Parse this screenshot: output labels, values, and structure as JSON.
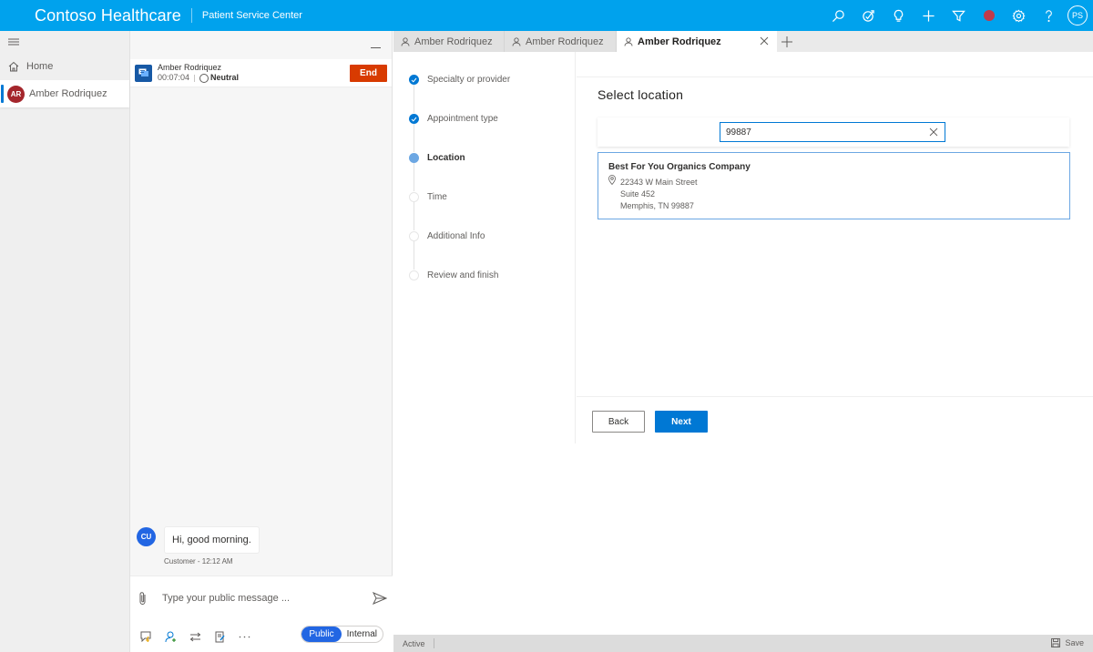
{
  "app": {
    "title": "Contoso Healthcare",
    "subtitle": "Patient Service Center",
    "brand_color": "#00a2ed",
    "header_actions": [
      {
        "name": "search-icon",
        "label": "Search"
      },
      {
        "name": "assistant-icon",
        "label": "Assistant"
      },
      {
        "name": "lightbulb-icon",
        "label": "Insights"
      },
      {
        "name": "plus-icon",
        "label": "New"
      },
      {
        "name": "filter-icon",
        "label": "Filter"
      },
      {
        "name": "presence-status-icon",
        "label": "Presence",
        "color": "#c23a4a"
      },
      {
        "name": "gear-icon",
        "label": "Settings"
      },
      {
        "name": "help-icon",
        "label": "Help"
      }
    ],
    "user_initials": "PS"
  },
  "leftnav": {
    "home_label": "Home",
    "session": {
      "initials": "AR",
      "name": "Amber Rodriquez",
      "avatar_color": "#a4262c"
    }
  },
  "conversation": {
    "session_card": {
      "name": "Amber Rodriquez",
      "timer": "00:07:04",
      "sentiment": "Neutral",
      "end_label": "End",
      "end_color": "#d83b01"
    },
    "messages": [
      {
        "initials": "CU",
        "text": "Hi, good morning.",
        "meta": "Customer - 12:12 AM"
      }
    ],
    "composer": {
      "placeholder": "Type your public message ...",
      "value": "",
      "toggle": {
        "options": [
          "Public",
          "Internal"
        ],
        "selected": "Public"
      }
    },
    "tools": [
      "quick-replies-icon",
      "consult-icon",
      "transfer-icon",
      "notes-icon",
      "more-icon"
    ]
  },
  "tabs": [
    {
      "label": "Amber Rodriquez",
      "active": false
    },
    {
      "label": "Amber Rodriquez",
      "active": false
    },
    {
      "label": "Amber Rodriquez",
      "active": true
    }
  ],
  "stepper": {
    "steps": [
      {
        "label": "Specialty or provider",
        "state": "done"
      },
      {
        "label": "Appointment type",
        "state": "done"
      },
      {
        "label": "Location",
        "state": "current"
      },
      {
        "label": "Time",
        "state": "todo"
      },
      {
        "label": "Additional Info",
        "state": "todo"
      },
      {
        "label": "Review and finish",
        "state": "todo"
      }
    ]
  },
  "main": {
    "heading": "Select location",
    "search": {
      "value": "99887",
      "placeholder": ""
    },
    "results": [
      {
        "name": "Best For You Organics Company",
        "address_line1": "22343 W Main Street",
        "address_line2": "Suite 452",
        "address_line3": "Memphis, TN 99887"
      }
    ],
    "back_label": "Back",
    "next_label": "Next"
  },
  "statusbar": {
    "status": "Active",
    "save_label": "Save"
  }
}
